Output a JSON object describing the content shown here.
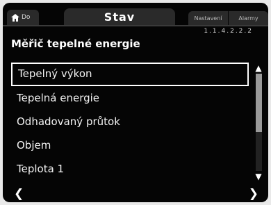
{
  "header": {
    "home_label": "Do",
    "title": "Stav",
    "settings_label": "Nastavení",
    "alarms_label": "Alarmy"
  },
  "page": {
    "code": "1.1.4.2.2.2",
    "heading": "Měřič tepelné energie"
  },
  "list": {
    "items": [
      {
        "label": "Tepelný výkon",
        "selected": true
      },
      {
        "label": "Tepelná energie",
        "selected": false
      },
      {
        "label": "Odhadovaný průtok",
        "selected": false
      },
      {
        "label": "Objem",
        "selected": false
      },
      {
        "label": "Teplota 1",
        "selected": false
      }
    ]
  },
  "scrollbar": {
    "position_fraction": 0.0,
    "visible_fraction": 0.6
  },
  "nav": {
    "left_icon": "chevron-left-icon",
    "right_icon": "chevron-right-icon"
  },
  "colors": {
    "background": "#050505",
    "tab": "#2a2a2a",
    "text": "#ffffff"
  }
}
